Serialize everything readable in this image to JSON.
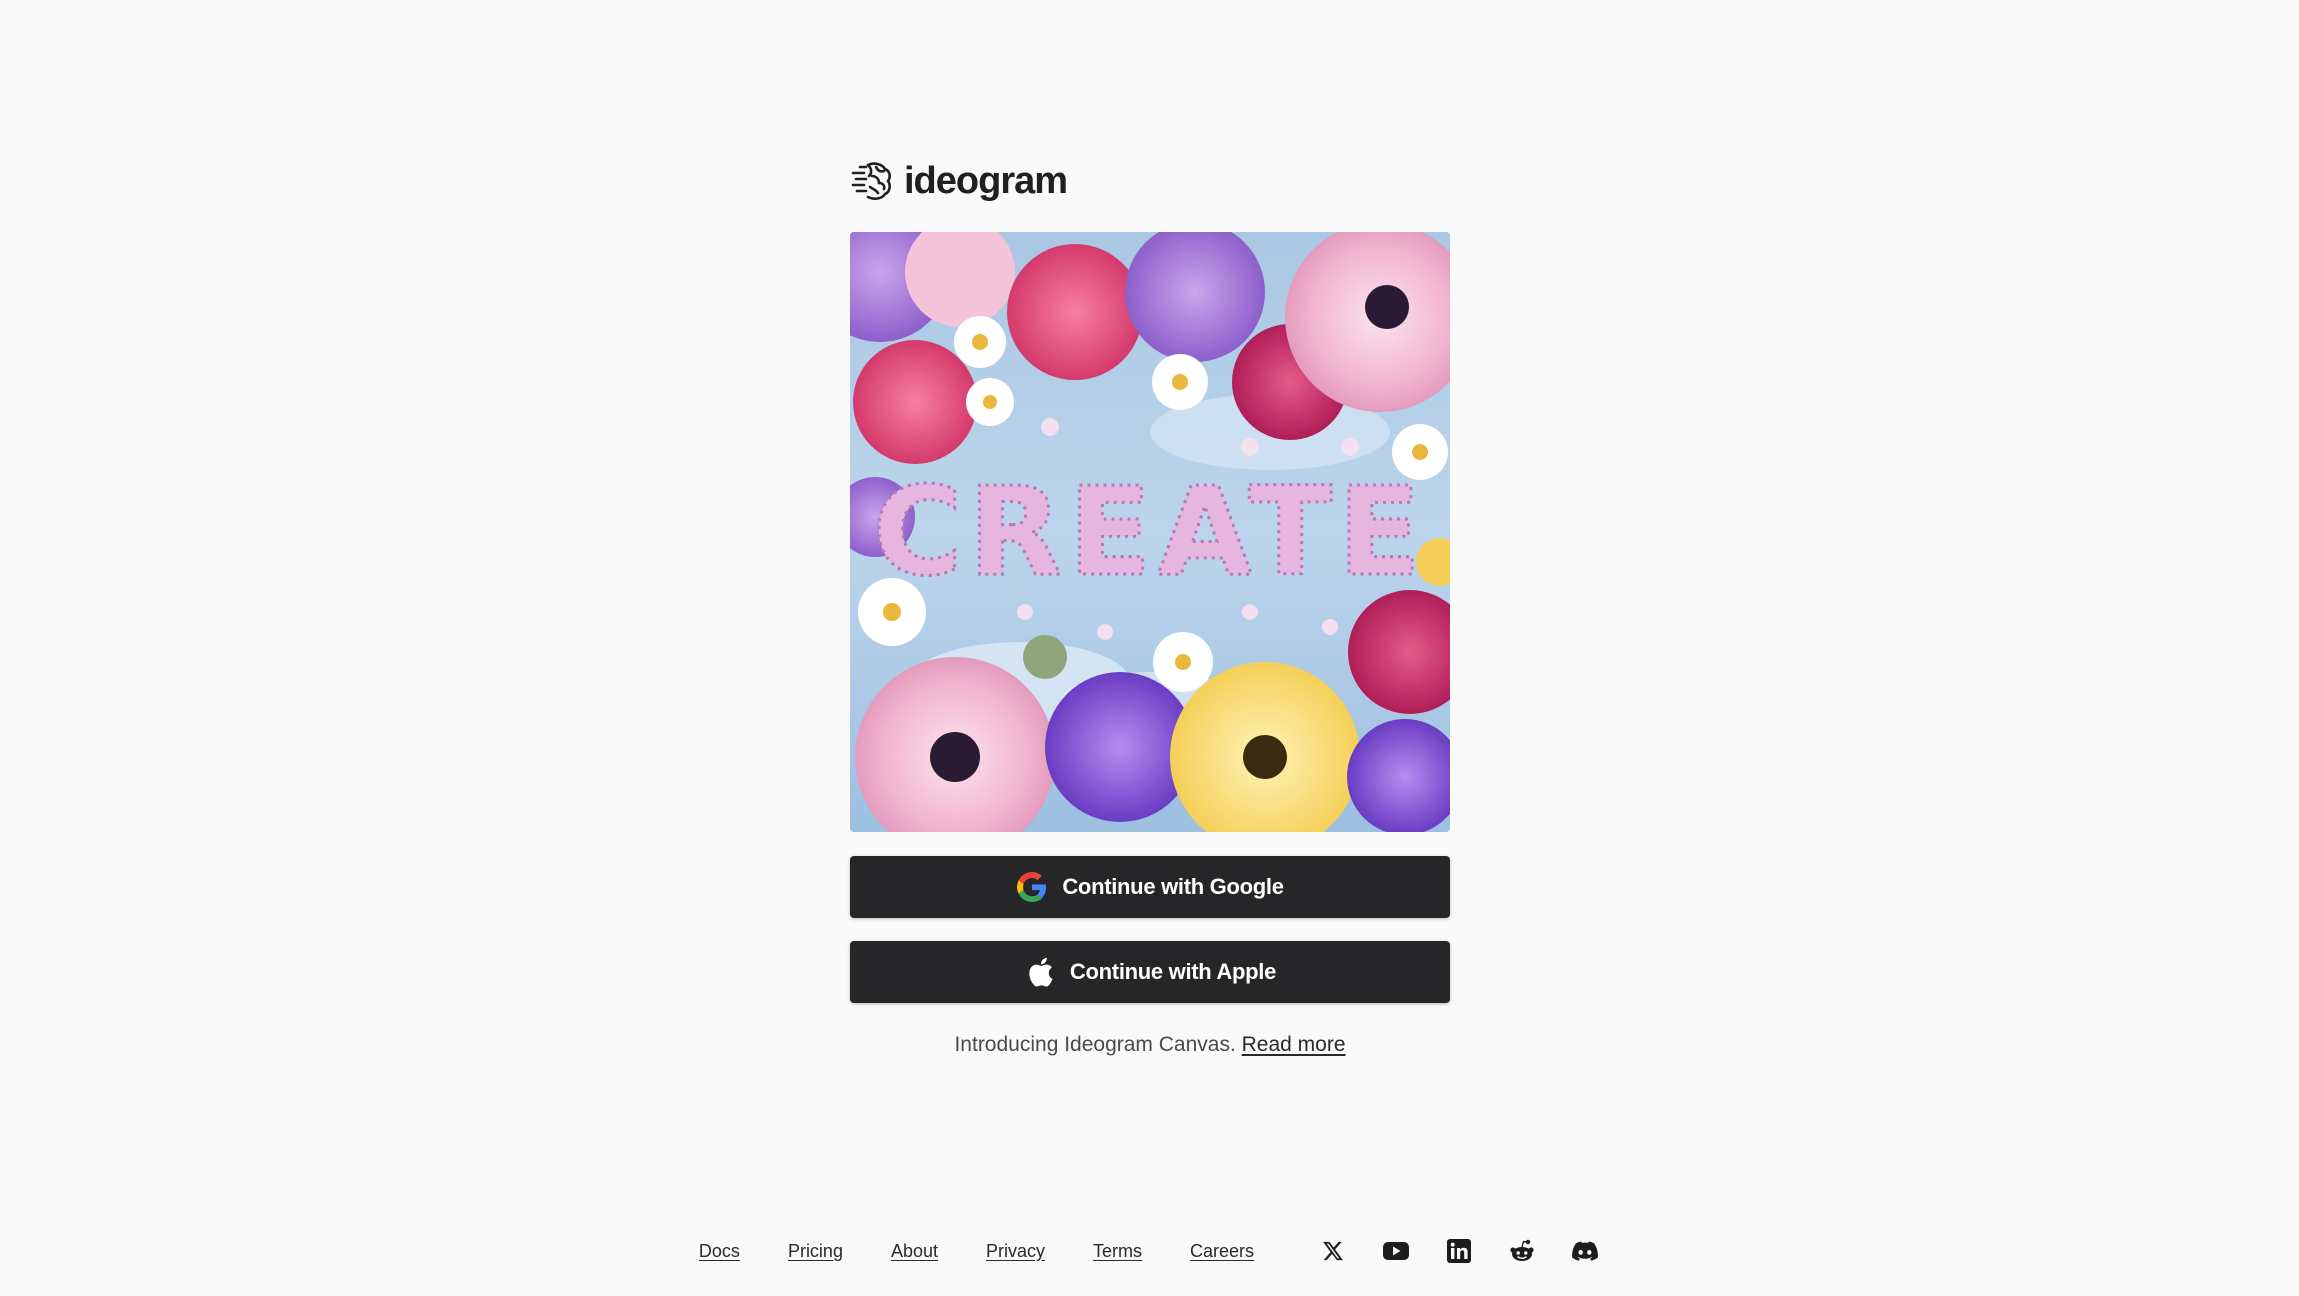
{
  "brand": {
    "name": "ideogram",
    "logo_icon": "ideogram-brain-icon"
  },
  "hero": {
    "image_icon": "flower-create-artwork",
    "image_text": "CREATE"
  },
  "auth": {
    "google_label": "Continue with Google",
    "google_icon": "google-icon",
    "apple_label": "Continue with Apple",
    "apple_icon": "apple-icon",
    "button_color": "#262628"
  },
  "announcement": {
    "text": "Introducing Ideogram Canvas.",
    "link_label": "Read more"
  },
  "footer": {
    "links": [
      "Docs",
      "Pricing",
      "About",
      "Privacy",
      "Terms",
      "Careers"
    ],
    "social": [
      "x-icon",
      "youtube-icon",
      "linkedin-icon",
      "reddit-icon",
      "discord-icon"
    ]
  },
  "colors": {
    "background": "#f9f9f9",
    "text": "#2a2a2c",
    "muted_text": "#4a4a4e"
  }
}
